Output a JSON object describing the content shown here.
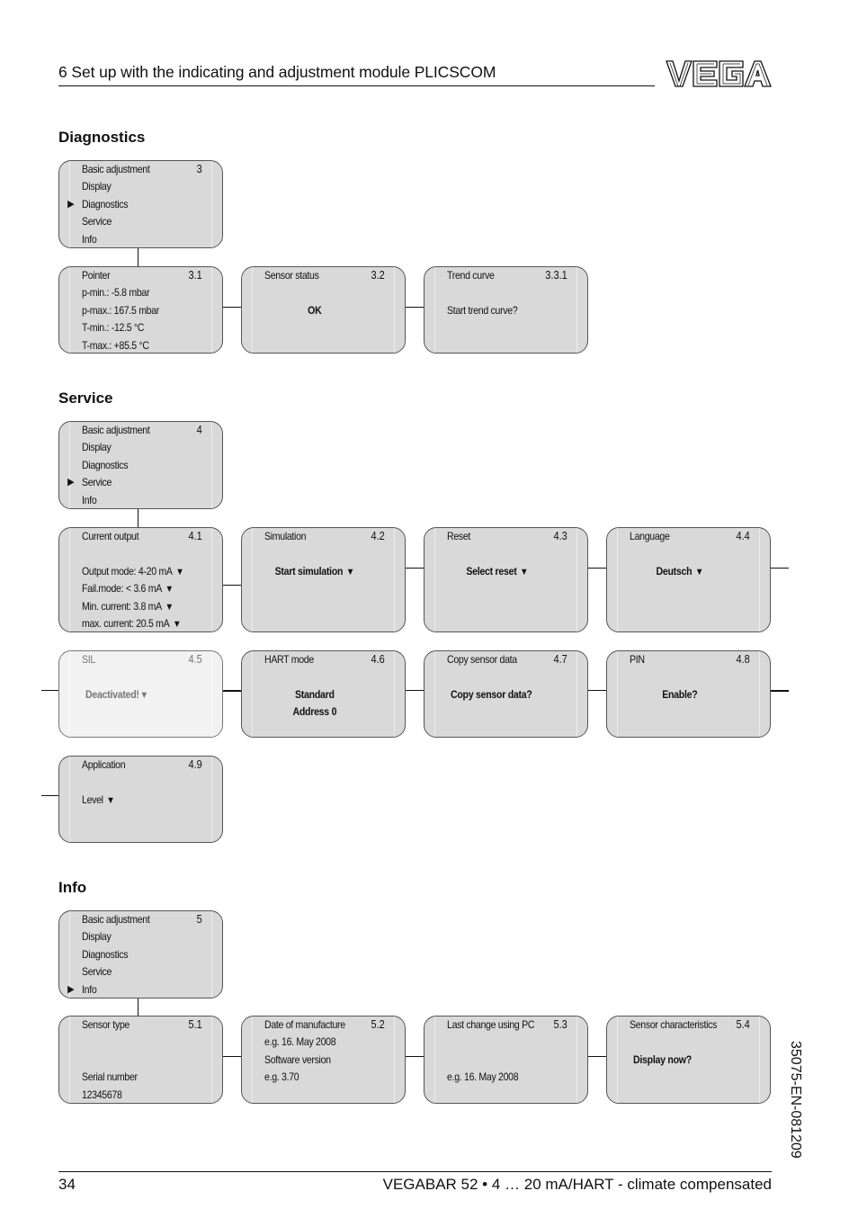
{
  "header": {
    "title": "6   Set up with the indicating and adjustment module PLICSCOM",
    "logo_text": "VEGA"
  },
  "sections": {
    "diagnostics": {
      "title": "Diagnostics",
      "menu": {
        "number": "3",
        "items": [
          "Basic adjustment",
          "Display",
          "Diagnostics",
          "Service",
          "Info"
        ],
        "selected_index": 2,
        "pointer_icon": "▶"
      },
      "boxes": [
        {
          "title": "Pointer",
          "number": "3.1",
          "lines": [
            "p-min.: -5.8 mbar",
            "p-max.: 167.5 mbar",
            "T-min.: -12.5 °C",
            "T-max.: +85.5 °C"
          ]
        },
        {
          "title": "Sensor status",
          "number": "3.2",
          "value": "OK"
        },
        {
          "title": "Trend curve",
          "number": "3.3.1",
          "value": "Start trend curve?"
        }
      ]
    },
    "service": {
      "title": "Service",
      "menu": {
        "number": "4",
        "items": [
          "Basic adjustment",
          "Display",
          "Diagnostics",
          "Service",
          "Info"
        ],
        "selected_index": 3,
        "pointer_icon": "▶"
      },
      "boxes": [
        {
          "title": "Current output",
          "number": "4.1",
          "lines": [
            "Output mode: 4-20 mA",
            "Fail.mode: < 3.6 mA",
            "Min. current: 3.8 mA",
            "max. current: 20.5 mA"
          ]
        },
        {
          "title": "Simulation",
          "number": "4.2",
          "value": "Start simulation"
        },
        {
          "title": "Reset",
          "number": "4.3",
          "value": "Select reset"
        },
        {
          "title": "Language",
          "number": "4.4",
          "value": "Deutsch"
        },
        {
          "title": "SIL",
          "number": "4.5",
          "value": "Deactivated!",
          "state": "disabled"
        },
        {
          "title": "HART mode",
          "number": "4.6",
          "lines": [
            "Standard",
            "Address 0"
          ]
        },
        {
          "title": "Copy sensor data",
          "number": "4.7",
          "value": "Copy sensor data?"
        },
        {
          "title": "PIN",
          "number": "4.8",
          "value": "Enable?"
        },
        {
          "title": "Application",
          "number": "4.9",
          "value": "Level"
        }
      ],
      "dropdown_icon": "▼"
    },
    "info": {
      "title": "Info",
      "menu": {
        "number": "5",
        "items": [
          "Basic adjustment",
          "Display",
          "Diagnostics",
          "Service",
          "Info"
        ],
        "selected_index": 4,
        "pointer_icon": "▶"
      },
      "boxes": [
        {
          "title": "Sensor type",
          "number": "5.1",
          "lines": [
            "Serial number",
            "12345678"
          ]
        },
        {
          "title": "Date of manufacture",
          "number": "5.2",
          "lines": [
            "e.g. 16. May 2008",
            "Software version",
            "e.g. 3.70"
          ]
        },
        {
          "title": "Last change using PC",
          "number": "5.3",
          "value": "e.g. 16. May 2008"
        },
        {
          "title": "Sensor characteristics",
          "number": "5.4",
          "value": "Display now?"
        }
      ]
    }
  },
  "footer": {
    "page_number": "34",
    "title": "VEGABAR 52 • 4 … 20 mA/HART - climate compensated",
    "doc_code": "35075-EN-081209"
  }
}
